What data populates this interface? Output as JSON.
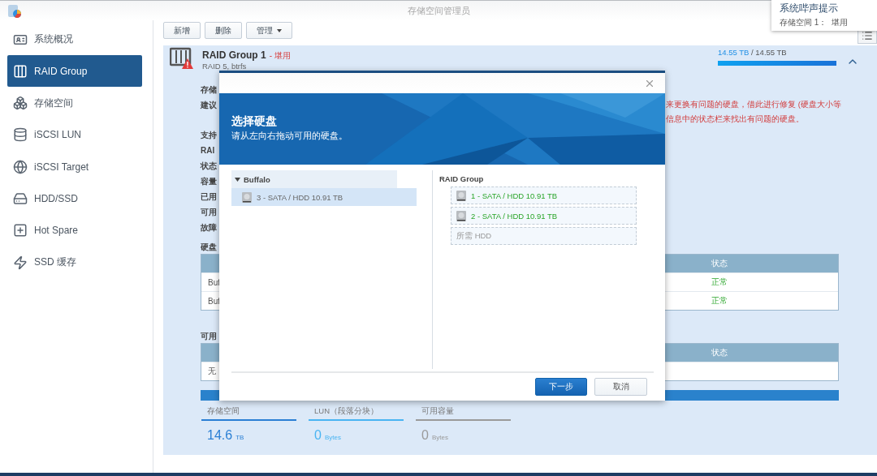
{
  "window": {
    "title": "存储空间管理员"
  },
  "notification": {
    "title": "系统哔声提示",
    "message": "存储空间 1：  堪用"
  },
  "sidebar": {
    "items": [
      {
        "label": "系统概况",
        "kind": "overview",
        "selected": false
      },
      {
        "label": "RAID Group",
        "kind": "raid",
        "selected": true
      },
      {
        "label": "存储空间",
        "kind": "volume",
        "selected": false
      },
      {
        "label": "iSCSI LUN",
        "kind": "lun",
        "selected": false
      },
      {
        "label": "iSCSI Target",
        "kind": "target",
        "selected": false
      },
      {
        "label": "HDD/SSD",
        "kind": "disk",
        "selected": false
      },
      {
        "label": "Hot Spare",
        "kind": "spare",
        "selected": false
      },
      {
        "label": "SSD 缓存",
        "kind": "cache",
        "selected": false
      }
    ]
  },
  "toolbar": {
    "buttons": [
      {
        "label": "新增",
        "kind": "plain"
      },
      {
        "label": "删除",
        "kind": "plain"
      },
      {
        "label": "管理",
        "kind": "dropdown"
      }
    ]
  },
  "raid_group": {
    "name": "RAID Group 1",
    "status": "- 堪用",
    "type": "RAID 5, btrfs",
    "used": "14.55 TB",
    "total": "/ 14.55 TB",
    "level": 1,
    "expanded": true,
    "details": [
      {
        "label": "存储"
      },
      {
        "label": "建议",
        "warning": [
          "来更换有问题的硬盘，借此进行修复 (硬盘大小等",
          "信息中的状态栏来找出有问题的硬盘。"
        ]
      },
      {
        "label": "支持"
      },
      {
        "label": "RAI"
      },
      {
        "label": "状态"
      },
      {
        "label": "容量"
      },
      {
        "label": "已用"
      },
      {
        "label": "可用"
      },
      {
        "label": "故障"
      }
    ],
    "tables": [
      {
        "title": "硬盘",
        "status_header": "状态",
        "rows": [
          {
            "name": "Buf",
            "status": "正常"
          },
          {
            "name": "Buf",
            "status": "正常"
          }
        ]
      },
      {
        "title": "可用",
        "status_header": "状态",
        "rows": [
          {
            "name": "无"
          }
        ]
      }
    ],
    "stats": [
      {
        "label": "存储空间",
        "value": "14.6",
        "unit": "TB",
        "color": "#2a7fd4"
      },
      {
        "label": "LUN（段落分块）",
        "value": "0",
        "unit": "Bytes",
        "color": "#49b4f2"
      },
      {
        "label": "可用容量",
        "value": "0",
        "unit": "Bytes",
        "color": "#9a9a9a"
      }
    ]
  },
  "dialog": {
    "title": "选择硬盘",
    "subtitle": "请从左向右拖动可用的硬盘。",
    "source": {
      "group": "Buffalo",
      "expanded": true,
      "disks": [
        {
          "label": "3 - SATA / HDD 10.91 TB",
          "selected": true
        }
      ]
    },
    "target": {
      "title": "RAID Group",
      "slots": [
        {
          "kind": "disk",
          "label": "1 - SATA / HDD 10.91 TB"
        },
        {
          "kind": "disk",
          "label": "2 - SATA / HDD 10.91 TB"
        },
        {
          "kind": "empty",
          "label": "所需 HDD"
        }
      ]
    },
    "buttons": [
      {
        "label": "下一步",
        "kind": "primary"
      },
      {
        "label": "取消",
        "kind": "secondary"
      }
    ]
  }
}
